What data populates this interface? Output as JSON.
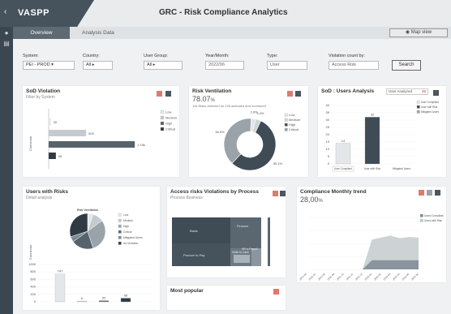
{
  "header": {
    "logo": "VASPP",
    "title": "GRC - Risk Compliance Analytics"
  },
  "tabs": {
    "overview": "Overview",
    "analysis": "Analysis Data",
    "map_view": "Map view"
  },
  "filters": {
    "system_label": "System:",
    "system_value": "PEI - PROD",
    "country_label": "Country:",
    "country_value": "All",
    "user_group_label": "User Group:",
    "user_group_value": "All",
    "year_month_label": "Year/Month:",
    "year_month_value": "2022/06",
    "type_label": "Type:",
    "type_value": "User",
    "violation_label": "Violation count by:",
    "violation_value": "Access Risk",
    "search_label": "Search"
  },
  "sod_violation": {
    "title": "SoD Violation",
    "subtitle": "Filter by System",
    "axis_label": "Connector",
    "legend": [
      "Low",
      "Medium",
      "High",
      "Critical"
    ],
    "chart_data": {
      "type": "bar",
      "orientation": "horizontal",
      "values": [
        30,
        500,
        1150,
        96
      ],
      "labels": [
        "30",
        "500",
        "1.15k",
        "96"
      ]
    }
  },
  "risk_ventilation": {
    "title": "Risk Ventilation",
    "percent": "78.07",
    "percent_unit": "%",
    "subtitle": "116 Risks detected on 228 activated and monitored",
    "legend": [
      "Low",
      "Medium",
      "High",
      "Critical"
    ],
    "chart_data": {
      "type": "pie",
      "values": [
        2.8,
        3.4,
        55.1,
        38.8
      ],
      "labels": [
        "2.8%",
        "3.4%",
        "55.1%",
        "38.8%"
      ]
    }
  },
  "sod_users": {
    "title": "SoD : Users Analysis",
    "dropdown": "User Analyzed",
    "dropdown_count": "49",
    "legend": [
      "User Compliant",
      "User with Risk",
      "Mitigated Users"
    ],
    "chart_data": {
      "type": "bar",
      "categories": [
        "User Compliant",
        "User with Risk",
        "Mitigated Users"
      ],
      "values": [
        14,
        32,
        0
      ],
      "labels": [
        "14",
        "32",
        ""
      ],
      "ylim": [
        0,
        40
      ],
      "yticks": [
        "40",
        "35",
        "30",
        "25",
        "20",
        "15",
        "10",
        "5",
        "0"
      ]
    }
  },
  "users_with_risks": {
    "title": "Users with Risks",
    "subtitle": "Detail analysis",
    "pie_title": "Risk Ventilation",
    "axis_label": "Connector",
    "legend": [
      "Low",
      "Medium",
      "High",
      "Critical",
      "Mitigated Users",
      "No Violation"
    ],
    "chart_data": {
      "type": "bar",
      "values": [
        747,
        6,
        32,
        98
      ],
      "labels": [
        "747",
        "6",
        "32",
        "98"
      ],
      "yticks": [
        "1000",
        "800",
        "600",
        "400",
        "200",
        "0"
      ]
    }
  },
  "access_risks": {
    "title": "Access risks Violations by Process",
    "subtitle": "Process Business",
    "tiles": [
      "Basis",
      "Procure to Pay",
      "Finance",
      "Order to Cash",
      "HR to Payroll"
    ]
  },
  "most_popular": {
    "title": "Most popular"
  },
  "compliance": {
    "title": "Compliance Monthly trend",
    "value": "28,00",
    "value_unit": "%",
    "legend": [
      "Users Compliant",
      "Users with Risk"
    ],
    "chart_data": {
      "type": "area",
      "x": [
        "2021-06",
        "2021-07",
        "2021-08",
        "2021-09",
        "2021-10",
        "2021-11",
        "2021-12",
        "2022-01",
        "2022-02",
        "2022-03",
        "2022-04",
        "2022-05",
        "2022-06"
      ],
      "series": [
        {
          "name": "Users with Risk",
          "values": [
            0,
            0,
            0,
            0,
            0,
            0,
            0,
            46,
            49,
            52,
            48,
            50,
            49
          ]
        },
        {
          "name": "Users Compliant",
          "values": [
            0,
            0,
            0,
            0,
            0,
            0,
            0,
            14,
            14,
            14,
            14,
            14,
            14
          ]
        }
      ]
    }
  },
  "colors": {
    "dark": "#3f4b55",
    "mid": "#6d7a84",
    "light": "#b8bfc4",
    "accent": "#e07a6e",
    "sidebar": "#3a4650"
  }
}
